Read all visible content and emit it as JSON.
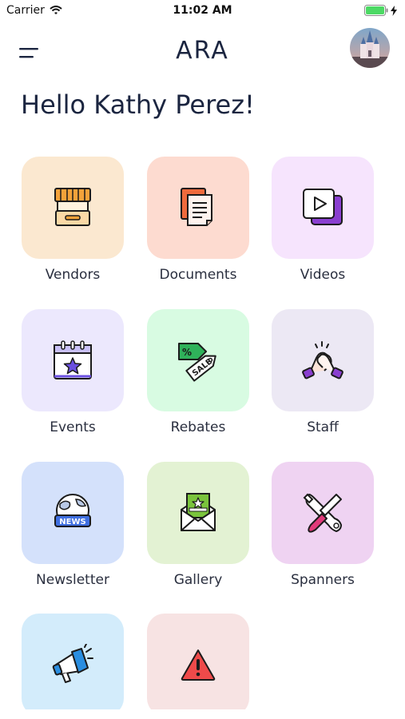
{
  "status_bar": {
    "carrier": "Carrier",
    "time": "11:02 AM",
    "battery_color": "#4cd964"
  },
  "header": {
    "title": "ARA",
    "menu_icon": "hamburger-icon",
    "avatar_icon": "castle-photo"
  },
  "greeting": "Hello Kathy Perez!",
  "tiles": [
    {
      "label": "Vendors",
      "icon": "market-stall-icon",
      "bg": "#fbe8d0"
    },
    {
      "label": "Documents",
      "icon": "documents-icon",
      "bg": "#fddbd0"
    },
    {
      "label": "Videos",
      "icon": "video-play-icon",
      "bg": "#f6e4fd"
    },
    {
      "label": "Events",
      "icon": "calendar-star-icon",
      "bg": "#ece8fd"
    },
    {
      "label": "Rebates",
      "icon": "sale-tags-icon",
      "bg": "#d8fbe2"
    },
    {
      "label": "Staff",
      "icon": "handshake-icon",
      "bg": "#ece8f4"
    },
    {
      "label": "Newsletter",
      "icon": "news-globe-icon",
      "bg": "#d4e1fb"
    },
    {
      "label": "Gallery",
      "icon": "envelope-picture-icon",
      "bg": "#e3f2d3"
    },
    {
      "label": "Spanners",
      "icon": "wrench-screwdriver-icon",
      "bg": "#efd3f2"
    },
    {
      "label": "",
      "icon": "megaphone-icon",
      "bg": "#d3ecfb"
    },
    {
      "label": "",
      "icon": "warning-icon",
      "bg": "#f7e3e3"
    }
  ]
}
